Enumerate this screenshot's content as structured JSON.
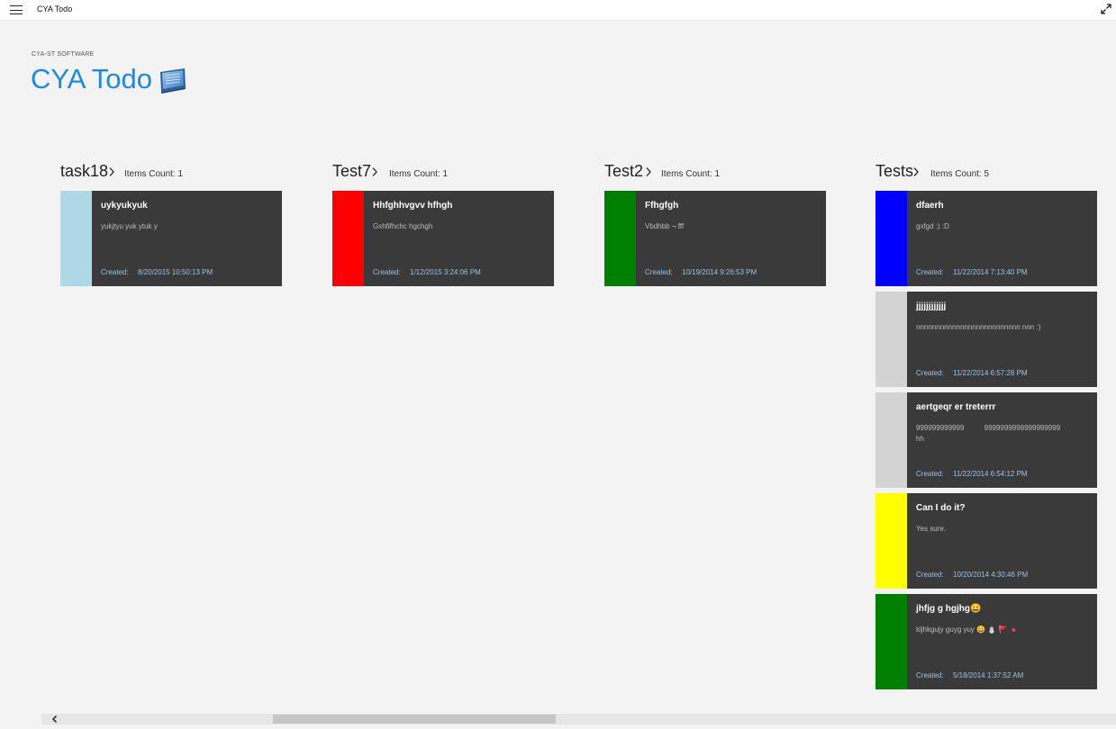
{
  "window": {
    "title": "CYA Todo",
    "menu_icon": "hamburger-menu-icon",
    "expand_icon": "expand-icon"
  },
  "header": {
    "company": "CYA-ST SOFTWARE",
    "title": "CYA Todo",
    "logo_icon": "notebook-logo-icon",
    "accent_color": "#1e88e5"
  },
  "groups": [
    {
      "name": "task18",
      "count_label": "Items Count: 1",
      "items": [
        {
          "title": "uykyukyuk",
          "description": "yukjtyu yuk ytuk y",
          "created_label": "Created:",
          "created": "8/20/2015 10:50:13 PM",
          "color": "#add8e6"
        }
      ]
    },
    {
      "name": "Test7",
      "count_label": "Items Count: 1",
      "items": [
        {
          "title": "Hhfghhvgvv hfhgh",
          "description": "Gxhfifhchc hgchgh",
          "created_label": "Created:",
          "created": "1/12/2015 3:24:06 PM",
          "color": "#ff0000"
        }
      ]
    },
    {
      "name": "Test2",
      "count_label": "Items Count: 1",
      "items": [
        {
          "title": "Ffhgfgh",
          "description": "Vbdhbb ¬ fff",
          "created_label": "Created:",
          "created": "10/19/2014 9:26:53 PM",
          "color": "#008000"
        }
      ]
    },
    {
      "name": "Tests",
      "count_label": "Items Count: 5",
      "items": [
        {
          "title": "dfaerh",
          "description": "gxfgd :) :D",
          "created_label": "Created:",
          "created": "11/22/2014 7:13:40 PM",
          "color": "#0000ff"
        },
        {
          "title": "jjjjjjjjjjjj",
          "description": "nnnnnnnnnnnnnnnnnnnnnnnnnn nnn :)",
          "created_label": "Created:",
          "created": "11/22/2014 6:57:28 PM",
          "color": "#d3d3d3"
        },
        {
          "title": "aertgeqr er treterrr",
          "description": "999999999999          9999999999999999999\nhh",
          "created_label": "Created:",
          "created": "11/22/2014 6:54:12 PM",
          "color": "#d3d3d3"
        },
        {
          "title": "Can I do it?",
          "description": "Yes sure.",
          "created_label": "Created:",
          "created": "10/20/2014 4:30:46 PM",
          "color": "#ffff00"
        },
        {
          "title": "jhfjg g hgjhg😀",
          "description": "kljhkgujy guyg yuy 😀 ⛄ 🚩 🔺",
          "created_label": "Created:",
          "created": "5/18/2014 1:37:52 AM",
          "color": "#008000"
        }
      ]
    }
  ],
  "scrollbar": {
    "left_arrow_icon": "chevron-left-icon",
    "position": 0.22
  }
}
